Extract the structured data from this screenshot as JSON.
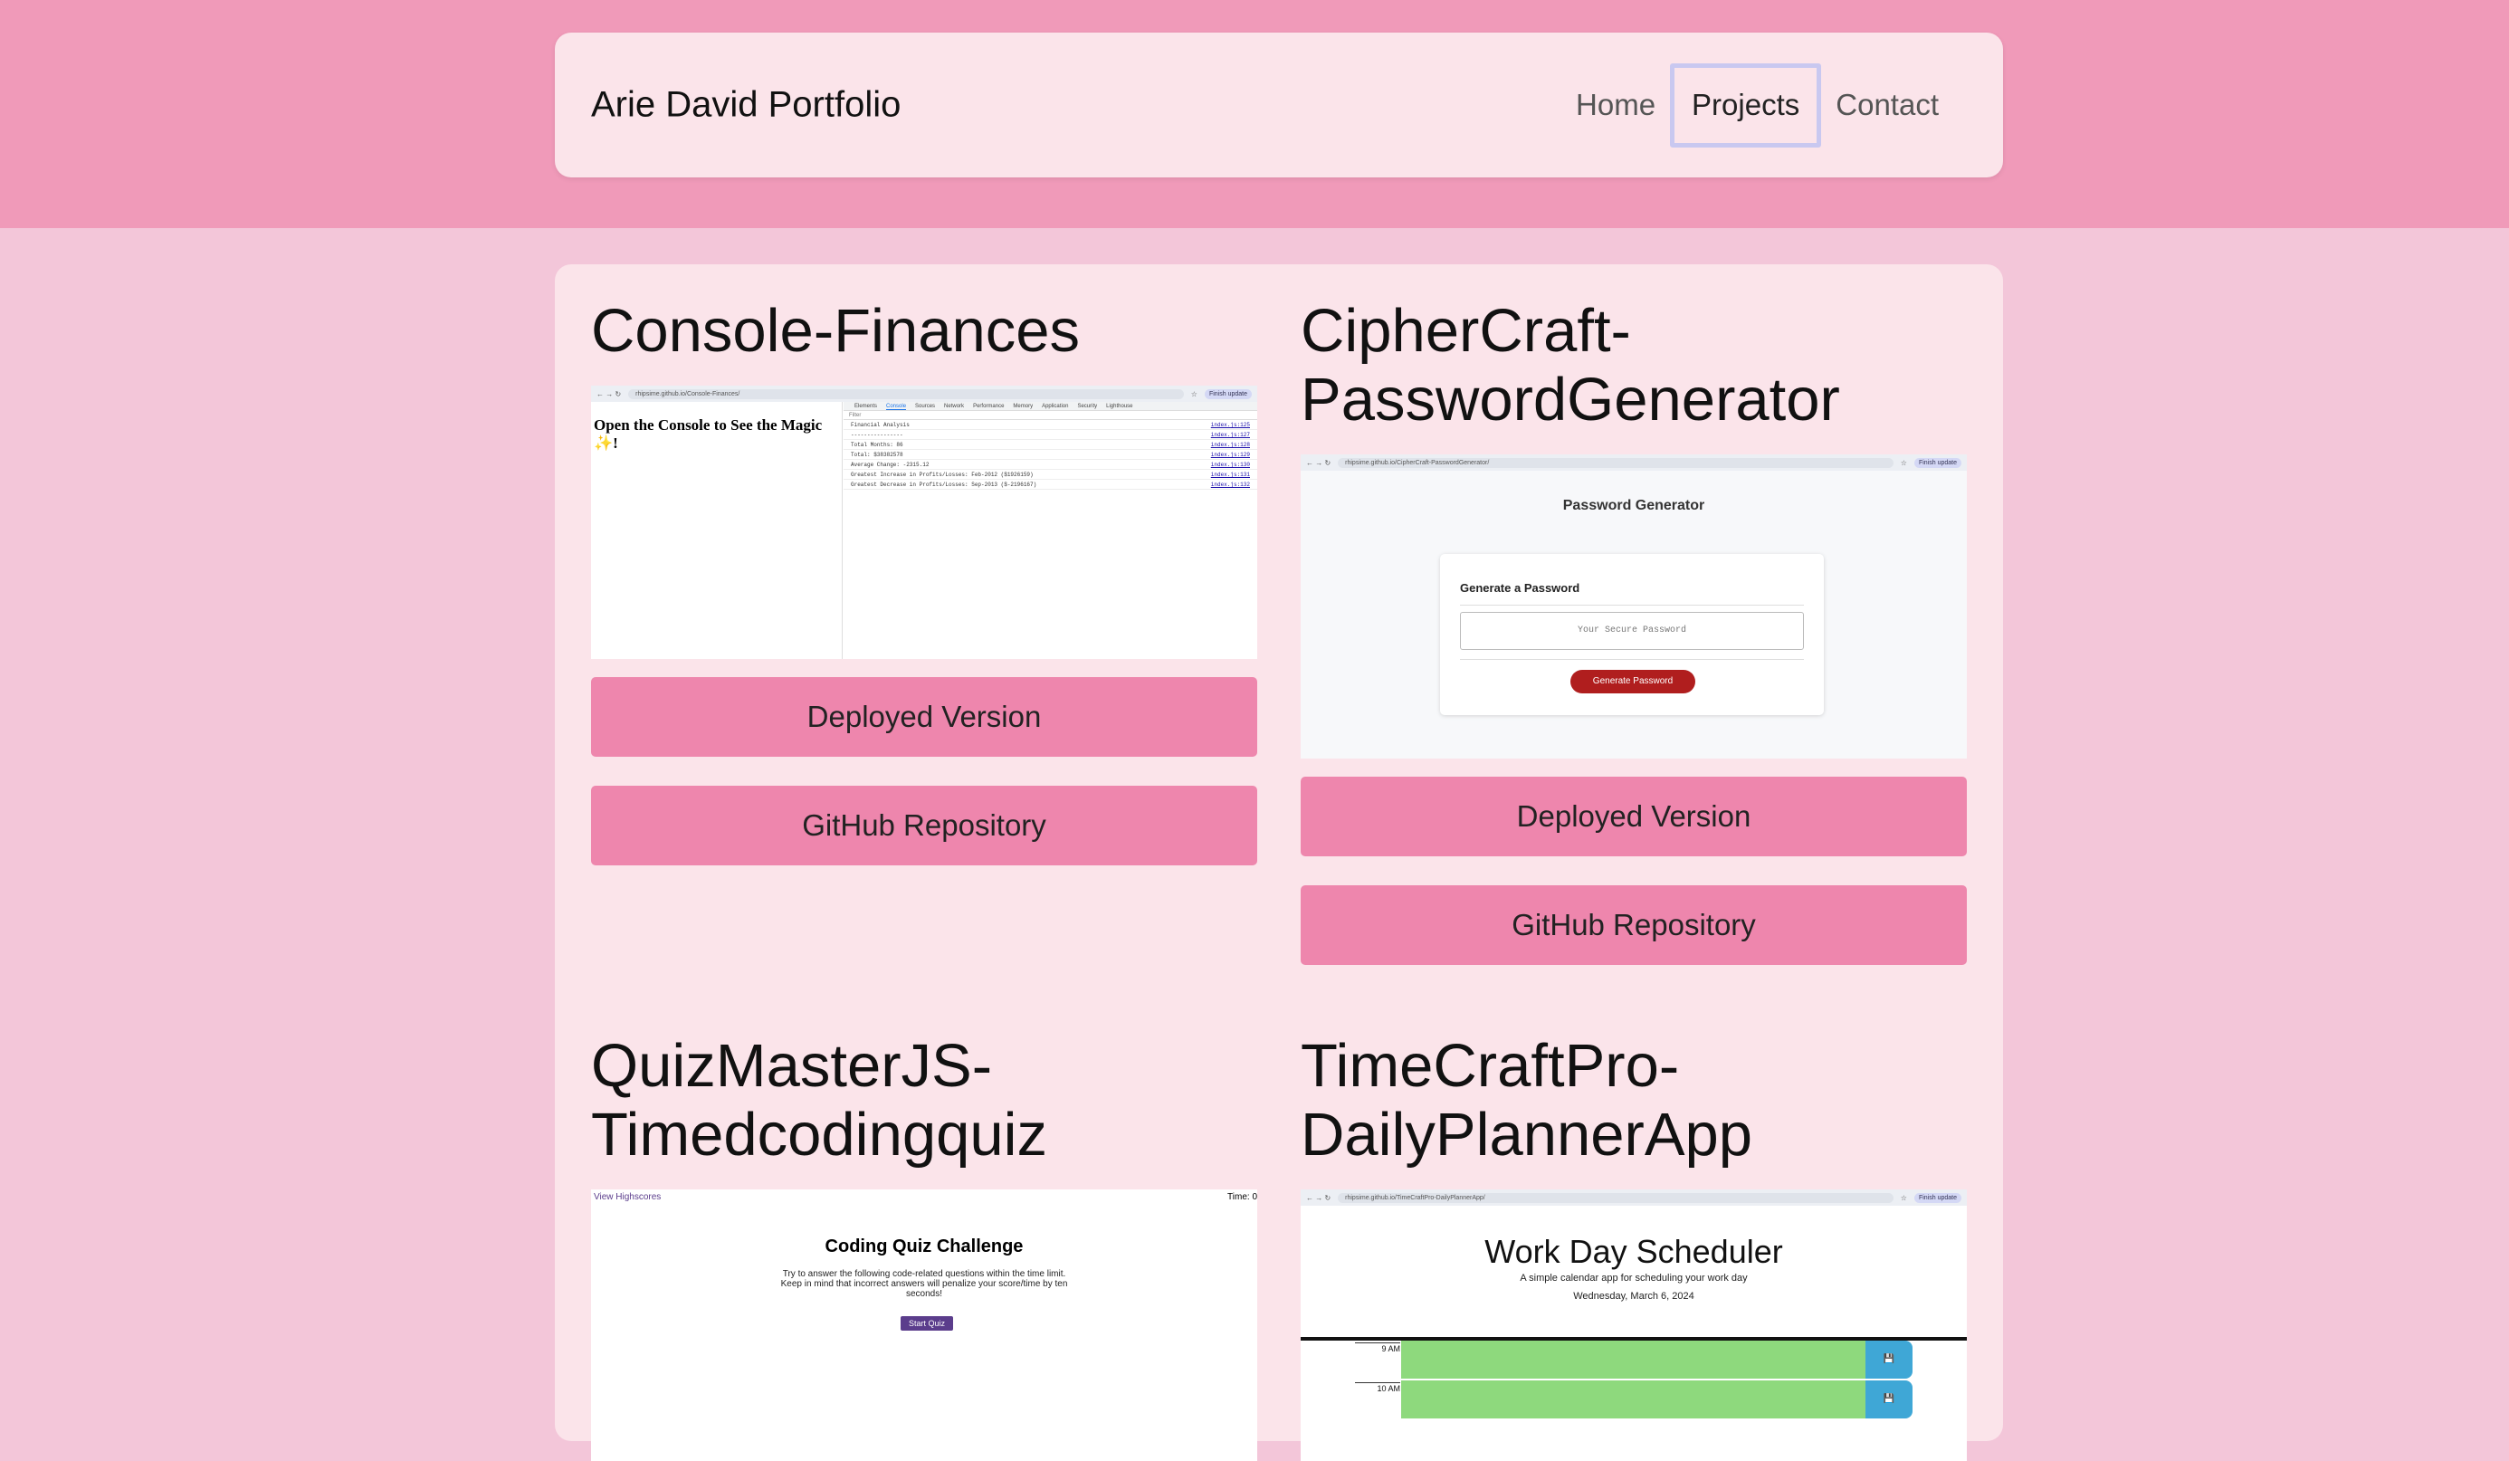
{
  "navbar": {
    "brand": "Arie David Portfolio",
    "links": [
      {
        "label": "Home"
      },
      {
        "label": "Projects",
        "active": true
      },
      {
        "label": "Contact"
      }
    ]
  },
  "projects": [
    {
      "title": "Console-Finances",
      "deployed_label": "Deployed Version",
      "github_label": "GitHub Repository",
      "screenshot": {
        "url": "rhipsime.github.io/Console-Finances/",
        "pill": "Finish update",
        "heading": "Open the Console to See the Magic ✨!",
        "tabs": [
          "Elements",
          "Console",
          "Sources",
          "Network",
          "Performance",
          "Memory",
          "Application",
          "Security",
          "Lighthouse"
        ],
        "filter": "Filter",
        "lines": [
          {
            "text": "Financial Analysis",
            "src": "index.js:125"
          },
          {
            "text": "----------------",
            "src": "index.js:127"
          },
          {
            "text": "Total Months: 86",
            "src": "index.js:128"
          },
          {
            "text": "Total: $38382578",
            "src": "index.js:129"
          },
          {
            "text": "Average Change: -2315.12",
            "src": "index.js:130"
          },
          {
            "text": "Greatest Increase in Profits/Losses: Feb-2012 ($1926159)",
            "src": "index.js:131"
          },
          {
            "text": "Greatest Decrease in Profits/Losses: Sep-2013 ($-2196167)",
            "src": "index.js:132"
          }
        ]
      }
    },
    {
      "title": "CipherCraft-PasswordGenerator",
      "deployed_label": "Deployed Version",
      "github_label": "GitHub Repository",
      "screenshot": {
        "url": "rhipsime.github.io/CipherCraft-PasswordGenerator/",
        "pill": "Finish update",
        "heading": "Password Generator",
        "card_heading": "Generate a Password",
        "placeholder": "Your Secure Password",
        "button": "Generate Password"
      }
    },
    {
      "title": "QuizMasterJS-Timedcodingquiz",
      "screenshot": {
        "highscores": "View Highscores",
        "time": "Time: 0",
        "heading": "Coding Quiz Challenge",
        "description": "Try to answer the following code-related questions within the time limit. Keep in mind that incorrect answers will penalize your score/time by ten seconds!",
        "button": "Start Quiz"
      }
    },
    {
      "title": "TimeCraftPro-DailyPlannerApp",
      "screenshot": {
        "url": "rhipsime.github.io/TimeCraftPro-DailyPlannerApp/",
        "pill": "Finish update",
        "heading": "Work Day Scheduler",
        "subheading": "A simple calendar app for scheduling your work day",
        "date": "Wednesday, March 6, 2024",
        "hours": [
          "9 AM",
          "10 AM"
        ]
      }
    }
  ],
  "colors": {
    "top_band": "#f09ab9",
    "page_bg": "#f3c6d9",
    "card_bg": "#fbe4ea",
    "button": "#ee86ad"
  }
}
